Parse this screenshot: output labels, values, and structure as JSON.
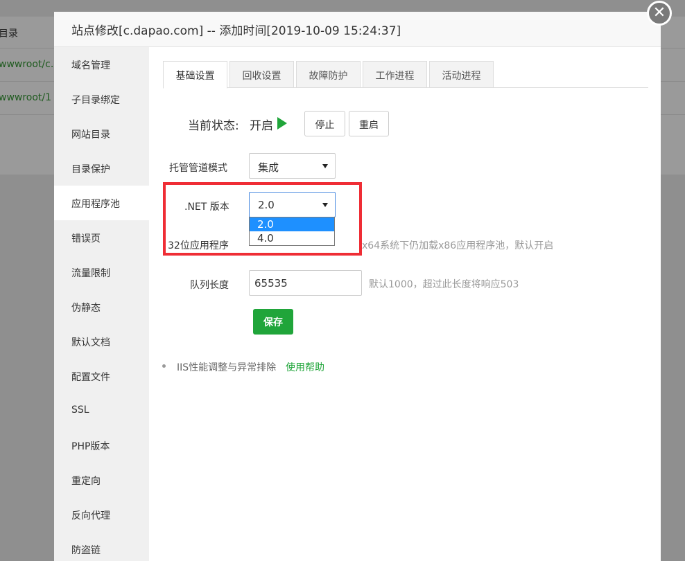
{
  "background": {
    "header_text": "目录",
    "rows": [
      "wwwroot/c.",
      "wwwroot/1"
    ]
  },
  "modal": {
    "title": "站点修改[c.dapao.com] -- 添加时间[2019-10-09 15:24:37]",
    "close_glyph": "✕"
  },
  "sidebar": {
    "items": [
      {
        "label": "域名管理"
      },
      {
        "label": "子目录绑定"
      },
      {
        "label": "网站目录"
      },
      {
        "label": "目录保护"
      },
      {
        "label": "应用程序池",
        "active": true
      },
      {
        "label": "错误页"
      },
      {
        "label": "流量限制"
      },
      {
        "label": "伪静态"
      },
      {
        "label": "默认文档"
      },
      {
        "label": "配置文件"
      },
      {
        "label": "SSL"
      },
      {
        "label": "PHP版本"
      },
      {
        "label": "重定向"
      },
      {
        "label": "反向代理"
      },
      {
        "label": "防盗链"
      }
    ]
  },
  "tabs": [
    {
      "label": "基础设置",
      "active": true
    },
    {
      "label": "回收设置"
    },
    {
      "label": "故障防护"
    },
    {
      "label": "工作进程"
    },
    {
      "label": "活动进程"
    }
  ],
  "status": {
    "label": "当前状态:",
    "value": "开启",
    "icon": "play-icon",
    "stop_label": "停止",
    "restart_label": "重启"
  },
  "form": {
    "pipeline_label": "托管管道模式",
    "pipeline_value": "集成",
    "net_label": ".NET 版本",
    "net_value": "2.0",
    "net_options": [
      "2.0",
      "4.0"
    ],
    "bit32_label": "32位应用程序",
    "bit32_hint": "x64系统下仍加载x86应用程序池，默认开启",
    "queue_label": "队列长度",
    "queue_value": "65535",
    "queue_hint": "默认1000，超过此长度将响应503",
    "save_label": "保存"
  },
  "tips": {
    "text": "IIS性能调整与异常排除",
    "link": "使用帮助"
  },
  "colors": {
    "accent": "#20a53a",
    "highlight": "#ef2d35",
    "dropdown_selected": "#1e90ff"
  }
}
